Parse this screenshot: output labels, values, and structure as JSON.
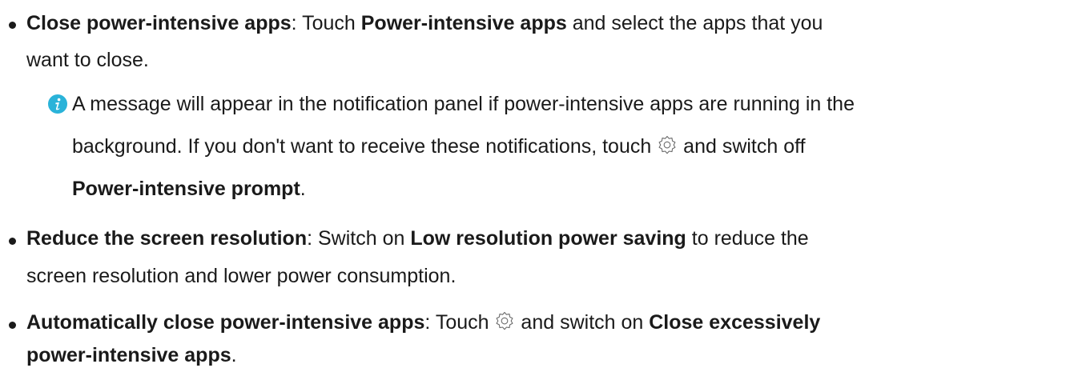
{
  "items": [
    {
      "title": "Close power-intensive apps",
      "colon": ":",
      "t1": " Touch ",
      "bold1": "Power-intensive apps",
      "t2": " and select the apps that you",
      "line2": "want to close."
    },
    {
      "title": "Reduce the screen resolution",
      "colon": ":",
      "t1": " Switch on ",
      "bold1": "Low resolution power saving",
      "t2": " to reduce the",
      "line2": "screen resolution and lower power consumption."
    },
    {
      "title": "Automatically close power-intensive apps",
      "colon": ":",
      "t1": " Touch ",
      "t2": " and switch on ",
      "bold1": "Close excessively",
      "line2_bold": "power-intensive apps",
      "line2_end": "."
    }
  ],
  "note": {
    "line1": "A message will appear in the notification panel if power-intensive apps are running in the",
    "line2_a": "background. If you don't want to receive these notifications, touch ",
    "line2_b": " and switch off",
    "line3_bold": "Power-intensive prompt",
    "line3_end": "."
  },
  "icons": {
    "info": "info-icon",
    "settings": "gear-icon"
  },
  "colors": {
    "info_icon": "#2ab3d9",
    "text": "#1a1a1a"
  }
}
